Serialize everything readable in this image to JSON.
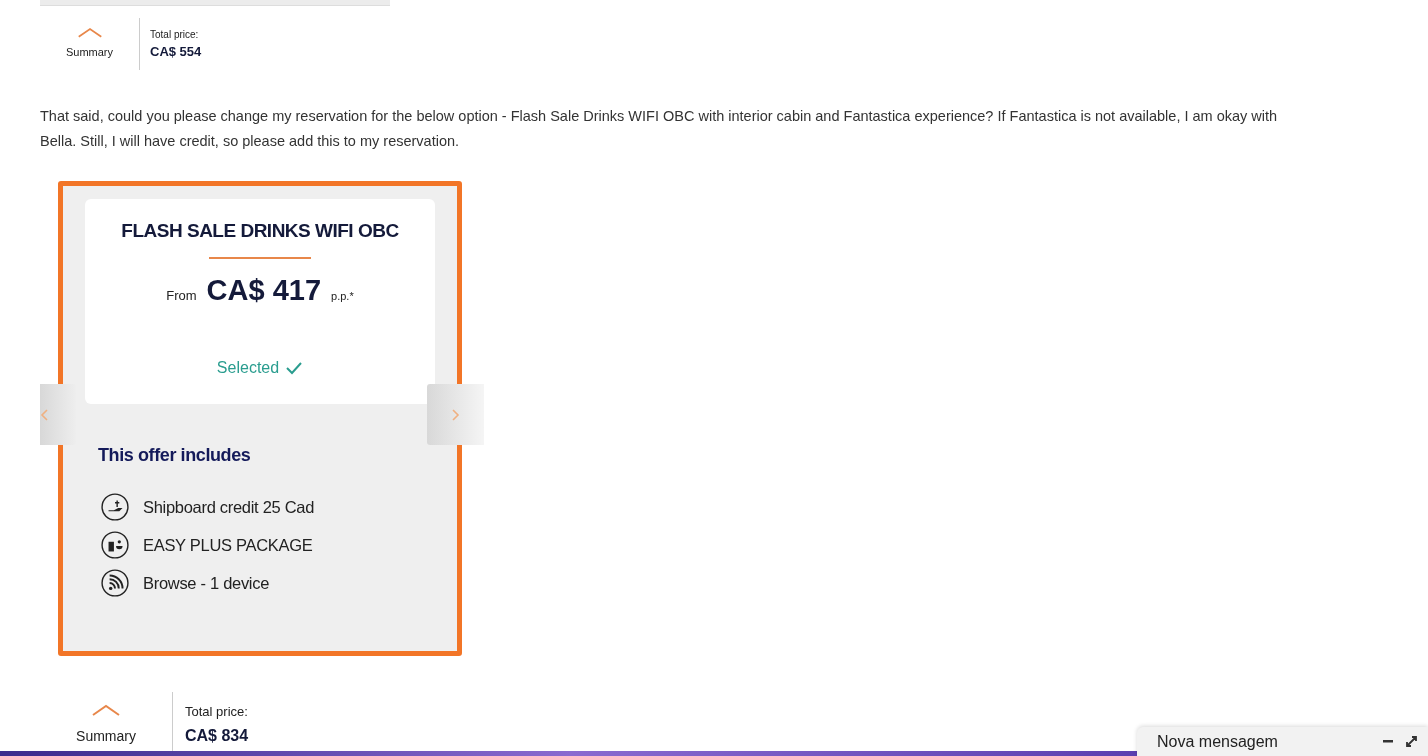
{
  "top_summary": {
    "label": "Summary",
    "total_label": "Total price:",
    "total": "CA$ 554"
  },
  "message": {
    "lines": [
      "That said, could you please change my reservation for the below option - Flash Sale Drinks WIFI OBC with interior cabin and Fantastica experience? If Fantastica is not available, I am okay with",
      "Bella. Still, I will have credit, so please add this to my reservation."
    ]
  },
  "offer_card": {
    "title": "FLASH SALE DRINKS WIFI OBC",
    "from": "From",
    "price": "CA$ 417",
    "per_person": "p.p.*",
    "selected": true,
    "selected_label": "Selected",
    "includes_title": "This offer includes",
    "items": [
      {
        "kind": "credit",
        "label": "Shipboard credit 25 Cad"
      },
      {
        "kind": "drinks",
        "label": "EASY PLUS PACKAGE"
      },
      {
        "kind": "wifi",
        "label": "Browse - 1 device"
      }
    ]
  },
  "bottom_summary": {
    "label": "Summary",
    "total_label": "Total price:",
    "total": "CA$ 834"
  },
  "compose": {
    "title": "Nova mensagem"
  }
}
